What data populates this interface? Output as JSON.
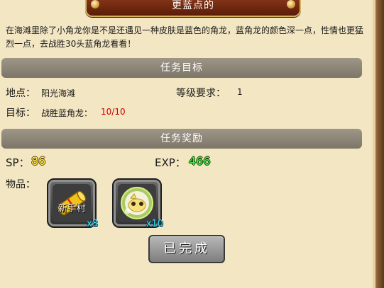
{
  "title": "更蓝点的",
  "description": "在海滩里除了小角龙你是不是还遇见一种皮肤是蓝色的角龙，蓝角龙的颜色深一点，性情也更猛烈一点，去战胜30头蓝角龙看看！",
  "objective_section": {
    "header": "任务目标",
    "location_label": "地点：",
    "location_value": "阳光海滩",
    "level_label": "等级要求：",
    "level_value": "1",
    "target_label": "目标：",
    "target_text": "战胜蓝角龙：",
    "target_progress": "10/10"
  },
  "reward_section": {
    "header": "任务奖励",
    "sp_label": "SP：",
    "sp_value": "86",
    "exp_label": "EXP：",
    "exp_value": "466",
    "items_label": "物品：",
    "items": [
      {
        "icon": "scroll-icon",
        "name": "新手村",
        "count": "x3"
      },
      {
        "icon": "dragon-orb-icon",
        "name": "",
        "count": "x10"
      }
    ]
  },
  "complete_button": "已完成",
  "colors": {
    "background": "#f3e6c3",
    "section_bar": "#8c8577",
    "sp_value": "#fff04a",
    "exp_value": "#4cf04a",
    "progress_red": "#c80000",
    "item_count": "#36e0ff"
  }
}
